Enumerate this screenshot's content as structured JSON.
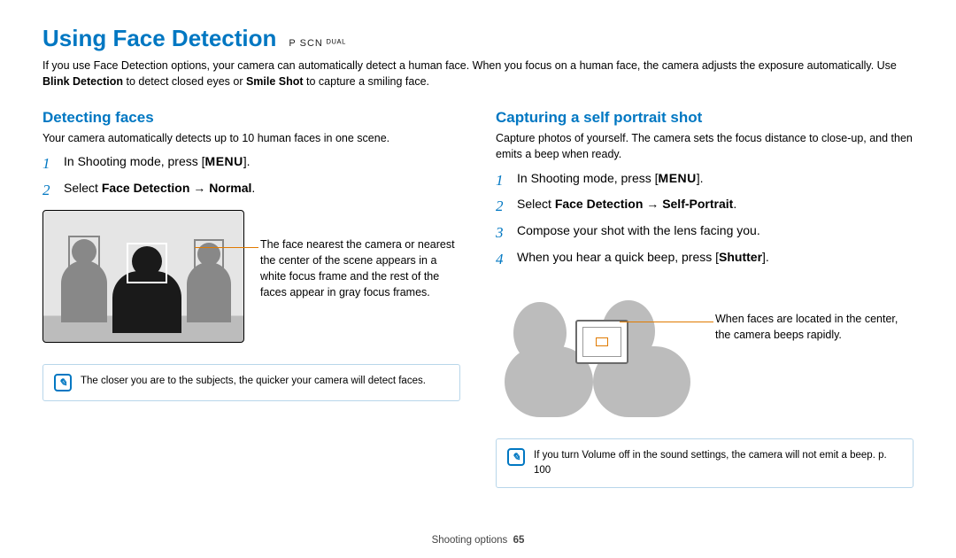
{
  "title": "Using Face Detection",
  "modes": "P  SCN  ᴰᵁᴬᴸ",
  "intro_parts": {
    "a": "If you use Face Detection options, your camera can automatically detect a human face. When you focus on a human face, the camera adjusts the exposure automatically. Use ",
    "b": "Blink Detection",
    "c": " to detect closed eyes or ",
    "d": "Smile Shot",
    "e": " to capture a smiling face."
  },
  "left": {
    "heading": "Detecting faces",
    "desc": "Your camera automatically detects up to 10 human faces in one scene.",
    "step1a": "In Shooting mode, press [",
    "menu": "MENU",
    "step1b": "].",
    "step2a": "Select ",
    "step2b": "Face Detection",
    "step2arrow": " → ",
    "step2c": "Normal",
    "step2d": ".",
    "caption": "The face nearest the camera or nearest the center of the scene appears in a white focus frame and the rest of the faces appear in gray focus frames.",
    "note": "The closer you are to the subjects, the quicker your camera will detect faces."
  },
  "right": {
    "heading": "Capturing a self portrait shot",
    "desc": "Capture photos of yourself. The camera sets the focus distance to close-up, and then emits a beep when ready.",
    "step1a": "In Shooting mode, press [",
    "menu": "MENU",
    "step1b": "].",
    "step2a": "Select ",
    "step2b": "Face Detection",
    "step2arrow": " → ",
    "step2c": "Self-Portrait",
    "step2d": ".",
    "step3": "Compose your shot with the lens facing you.",
    "step4a": "When you hear a quick beep, press [",
    "step4b": "Shutter",
    "step4c": "].",
    "caption": "When faces are located in the center, the camera beeps rapidly.",
    "note": "If you turn Volume off in the sound settings, the camera will not emit a beep. p. 100"
  },
  "footer_section": "Shooting options",
  "footer_page": "65"
}
